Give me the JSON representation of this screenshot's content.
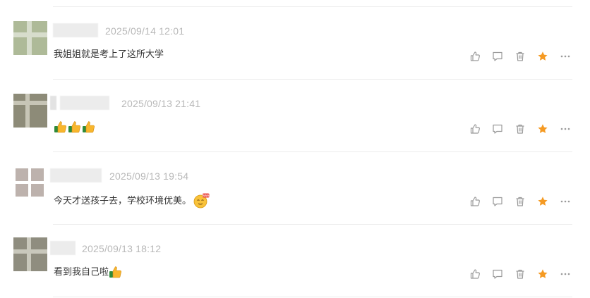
{
  "comments": [
    {
      "timestamp": "2025/09/14 12:01",
      "text": "我姐姐就是考上了这所大学",
      "emojis": [],
      "starred": true
    },
    {
      "timestamp": "2025/09/13 21:41",
      "text": "",
      "emojis": [
        "thumbs-up-icon",
        "thumbs-up-icon",
        "thumbs-up-icon"
      ],
      "starred": true
    },
    {
      "timestamp": "2025/09/13 19:54",
      "text": "今天才送孩子去，学校环境优美。",
      "emojis": [
        "face-666-icon"
      ],
      "starred": true
    },
    {
      "timestamp": "2025/09/13 18:12",
      "text": "看到我自己啦",
      "emojis": [
        "thumbs-up-icon"
      ],
      "starred": true
    }
  ],
  "action_icons": [
    "like-icon",
    "reply-icon",
    "delete-icon",
    "star-icon",
    "more-icon"
  ],
  "colors": {
    "star": "#f59a23",
    "icon_gray": "#9a9a9a",
    "timestamp": "#b8b8b8",
    "text": "#333333",
    "thumb_yellow": "#f8b62d",
    "thumb_green": "#2e8b3a"
  }
}
